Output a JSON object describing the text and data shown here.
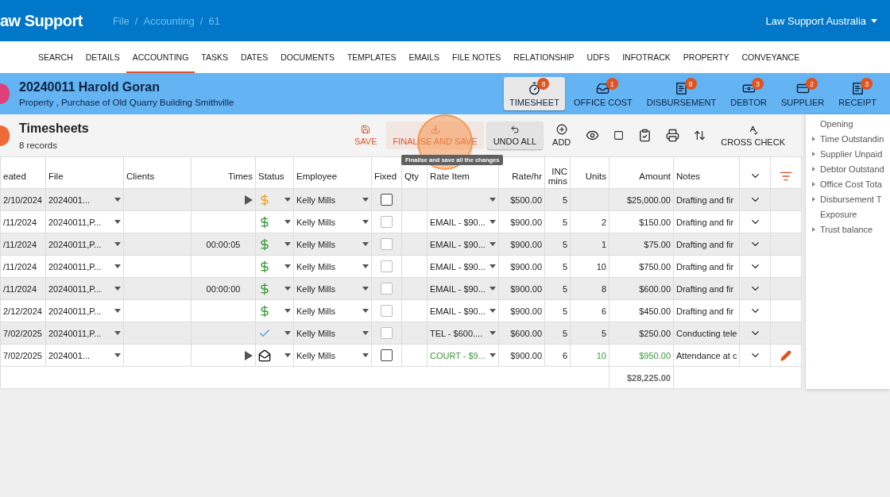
{
  "app_bar": {
    "brand": "aw Support",
    "breadcrumbs": [
      {
        "kind": "link",
        "text": "File"
      },
      {
        "kind": "sep",
        "text": "/"
      },
      {
        "kind": "link",
        "text": "Accounting"
      },
      {
        "kind": "sep",
        "text": "/"
      },
      {
        "kind": "link",
        "text": "61"
      }
    ],
    "account": "Law Support Australia"
  },
  "nav_tabs": [
    {
      "label": "SEARCH",
      "selected": false
    },
    {
      "label": "DETAILS",
      "selected": false
    },
    {
      "label": "ACCOUNTING",
      "selected": true
    },
    {
      "label": "TASKS",
      "selected": false
    },
    {
      "label": "DATES",
      "selected": false
    },
    {
      "label": "DOCUMENTS",
      "selected": false
    },
    {
      "label": "TEMPLATES",
      "selected": false
    },
    {
      "label": "EMAILS",
      "selected": false
    },
    {
      "label": "FILE NOTES",
      "selected": false
    },
    {
      "label": "RELATIONSHIP",
      "selected": false
    },
    {
      "label": "UDFS",
      "selected": false
    },
    {
      "label": "INFOTRACK",
      "selected": false
    },
    {
      "label": "PROPERTY",
      "selected": false
    },
    {
      "label": "CONVEYANCE",
      "selected": false
    }
  ],
  "record": {
    "title": "20240011 Harold Goran",
    "subtitle": "Property , Purchase of Old Quarry Building Smithville"
  },
  "record_tabs": [
    {
      "kind": "timer",
      "label": "TIMESHEET",
      "badge": "8",
      "selected": true
    },
    {
      "kind": "inbox",
      "label": "OFFICE COST",
      "badge": "1",
      "selected": false
    },
    {
      "kind": "list",
      "label": "DISBURSEMENT",
      "badge": "8",
      "selected": false
    },
    {
      "kind": "money",
      "label": "DEBTOR",
      "badge": "3",
      "selected": false
    },
    {
      "kind": "card",
      "label": "SUPPLIER",
      "badge": "2",
      "selected": false
    },
    {
      "kind": "list",
      "label": "RECEIPT",
      "badge": "3",
      "selected": false
    }
  ],
  "section": {
    "title": "Timesheets",
    "count": "8 records"
  },
  "actions": [
    {
      "kind": "save",
      "label": "SAVE"
    },
    {
      "kind": "finalise",
      "label": "FINALISE AND SAVE"
    },
    {
      "kind": "undo",
      "label": "UNDO ALL"
    },
    {
      "kind": "add",
      "label": "ADD"
    },
    {
      "kind": "eye"
    },
    {
      "kind": "square"
    },
    {
      "kind": "clipboard"
    },
    {
      "kind": "print"
    },
    {
      "kind": "sort"
    },
    {
      "kind": "crosscheck",
      "label": "CROSS CHECK"
    }
  ],
  "tooltip": "Finalise and save all the changes",
  "table": {
    "columns": [
      "eated",
      "File",
      "Clients",
      "Times",
      "Status",
      "Employee",
      "Fixed",
      "Qty",
      "Rate Item",
      "Rate/hr",
      "INC mins",
      "Units",
      "Amount",
      "Notes"
    ],
    "rows": [
      {
        "created": "2/10/2024",
        "file": "2024001...",
        "times": "",
        "timer": true,
        "status": {
          "kind": "pending"
        },
        "employee": "Kelly Mills",
        "fixed_disabled": false,
        "rate_item": "",
        "rate": "$500.00",
        "inc": "5",
        "units": "",
        "amount": "$25,000.00",
        "notes": "Drafting and fir",
        "editing": false
      },
      {
        "created": "/11/2024",
        "file": "20240011,P...",
        "times": "",
        "timer": false,
        "status": {
          "kind": "billed"
        },
        "employee": "Kelly Mills",
        "fixed_disabled": true,
        "rate_item": "EMAIL - $90...",
        "rate": "$900.00",
        "inc": "5",
        "units": "2",
        "amount": "$150.00",
        "notes": "Drafting and fir",
        "editing": false
      },
      {
        "created": "/11/2024",
        "file": "20240011,P...",
        "times": "00:00:05",
        "timer": false,
        "status": {
          "kind": "billed"
        },
        "employee": "Kelly Mills",
        "fixed_disabled": true,
        "rate_item": "EMAIL - $90...",
        "rate": "$900.00",
        "inc": "5",
        "units": "1",
        "amount": "$75.00",
        "notes": "Drafting and fir",
        "editing": false
      },
      {
        "created": "/11/2024",
        "file": "20240011,P...",
        "times": "",
        "timer": false,
        "status": {
          "kind": "billed"
        },
        "employee": "Kelly Mills",
        "fixed_disabled": true,
        "rate_item": "EMAIL - $90...",
        "rate": "$900.00",
        "inc": "5",
        "units": "10",
        "amount": "$750.00",
        "notes": "Drafting and fir",
        "editing": false
      },
      {
        "created": "/11/2024",
        "file": "20240011,P...",
        "times": "00:00:00",
        "timer": false,
        "status": {
          "kind": "billed"
        },
        "employee": "Kelly Mills",
        "fixed_disabled": true,
        "rate_item": "EMAIL - $90...",
        "rate": "$900.00",
        "inc": "5",
        "units": "8",
        "amount": "$600.00",
        "notes": "Drafting and fir",
        "editing": false
      },
      {
        "created": "2/12/2024",
        "file": "20240011,P...",
        "times": "",
        "timer": false,
        "status": {
          "kind": "billed"
        },
        "employee": "Kelly Mills",
        "fixed_disabled": true,
        "rate_item": "EMAIL - $90...",
        "rate": "$900.00",
        "inc": "5",
        "units": "6",
        "amount": "$450.00",
        "notes": "Drafting and fir",
        "editing": false
      },
      {
        "created": "7/02/2025",
        "file": "20240011,P...",
        "times": "",
        "timer": false,
        "status": {
          "kind": "done"
        },
        "employee": "Kelly Mills",
        "fixed_disabled": true,
        "rate_item": "TEL - $600....",
        "rate": "$600.00",
        "inc": "5",
        "units": "5",
        "amount": "$250.00",
        "notes": "Conducting tele",
        "editing": false
      },
      {
        "created": "7/02/2025",
        "file": "2024001...",
        "times": "",
        "timer": true,
        "status": {
          "kind": "mail"
        },
        "employee": "Kelly Mills",
        "fixed_disabled": false,
        "rate_item": "COURT - $9...",
        "rate": "$900.00",
        "inc": "6",
        "units": "10",
        "amount": "$950.00",
        "notes": "Attendance at c",
        "editing": true
      }
    ],
    "total": "$28,225.00"
  },
  "summary": [
    {
      "label": "Opening",
      "expandable": false
    },
    {
      "label": "Time Outstandin",
      "expandable": true
    },
    {
      "label": "Supplier Unpaid",
      "expandable": true
    },
    {
      "label": "Debtor Outstand",
      "expandable": true
    },
    {
      "label": "Office Cost Tota",
      "expandable": true
    },
    {
      "label": "Disbursement T",
      "expandable": true
    },
    {
      "label": "Exposure",
      "expandable": false
    },
    {
      "label": "Trust balance",
      "expandable": true
    }
  ]
}
